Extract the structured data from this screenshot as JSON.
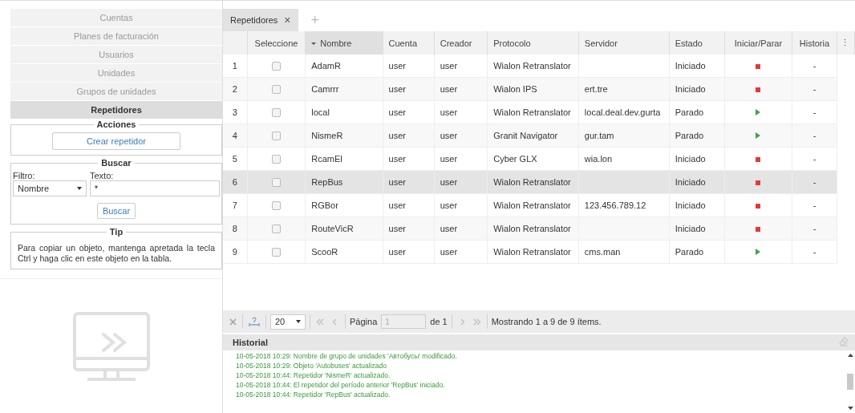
{
  "sidebar": {
    "items": [
      {
        "label": "Cuentas",
        "selected": false
      },
      {
        "label": "Planes de facturación",
        "selected": false
      },
      {
        "label": "Usuarios",
        "selected": false
      },
      {
        "label": "Unidades",
        "selected": false
      },
      {
        "label": "Grupos de unidades",
        "selected": false
      },
      {
        "label": "Repetidores",
        "selected": true
      }
    ]
  },
  "actions": {
    "legend": "Acciones",
    "button": "Crear repetidor"
  },
  "search": {
    "legend": "Buscar",
    "filter_label": "Filtro:",
    "filter_value": "Nombre",
    "text_label": "Texto:",
    "text_value": "*",
    "button": "Buscar"
  },
  "tip": {
    "legend": "Tip",
    "text": "Para copiar un objeto, mantenga apretada la tecla Ctrl y haga clic en este objeto en la tabla."
  },
  "tabs": [
    {
      "label": "Repetidores",
      "close": "×",
      "selected": true
    }
  ],
  "add_tab": "+",
  "table": {
    "columns": [
      {
        "sorted": false
      },
      {
        "label": "Seleccione",
        "sorted": false
      },
      {
        "label": "Nombre",
        "sorted": true
      },
      {
        "label": "Cuenta",
        "sorted": false
      },
      {
        "label": "Creador",
        "sorted": false
      },
      {
        "label": "Protocolo",
        "sorted": false
      },
      {
        "label": "Servidor",
        "sorted": false
      },
      {
        "label": "Estado",
        "sorted": false
      },
      {
        "label": "Iniciar/Parar",
        "sorted": false
      },
      {
        "label": "Historia",
        "sorted": false
      }
    ],
    "menu": "⋮",
    "rows": [
      {
        "num": "1",
        "checked": false,
        "name": "AdamR",
        "account": "user",
        "creator": "user",
        "protocol": "Wialon Retranslator",
        "server": "",
        "state": "Iniciado",
        "kind": "stop",
        "history": "-",
        "selected": false
      },
      {
        "num": "2",
        "checked": false,
        "name": "Camrrr",
        "account": "user",
        "creator": "user",
        "protocol": "Wialon IPS",
        "server": "ert.tre",
        "state": "Iniciado",
        "kind": "stop",
        "history": "-",
        "selected": false
      },
      {
        "num": "3",
        "checked": false,
        "name": "local",
        "account": "user",
        "creator": "user",
        "protocol": "Wialon Retranslator",
        "server": "local.deal.dev.gurta",
        "state": "Parado",
        "kind": "play",
        "history": "-",
        "selected": false
      },
      {
        "num": "4",
        "checked": false,
        "name": "NismeR",
        "account": "user",
        "creator": "user",
        "protocol": "Granit Navigator",
        "server": "gur.tam",
        "state": "Parado",
        "kind": "play",
        "history": "-",
        "selected": false
      },
      {
        "num": "5",
        "checked": false,
        "name": "RcamEl",
        "account": "user",
        "creator": "user",
        "protocol": "Cyber GLX",
        "server": "wia.lon",
        "state": "Iniciado",
        "kind": "stop",
        "history": "-",
        "selected": false
      },
      {
        "num": "6",
        "checked": false,
        "name": "RepBus",
        "account": "user",
        "creator": "user",
        "protocol": "Wialon Retranslator",
        "server": "",
        "state": "Iniciado",
        "kind": "stop",
        "history": "-",
        "selected": true
      },
      {
        "num": "7",
        "checked": false,
        "name": "RGBor",
        "account": "user",
        "creator": "user",
        "protocol": "Wialon Retranslator",
        "server": "123.456.789.12",
        "state": "Iniciado",
        "kind": "stop",
        "history": "-",
        "selected": false
      },
      {
        "num": "8",
        "checked": false,
        "name": "RouteVicR",
        "account": "user",
        "creator": "user",
        "protocol": "Wialon Retranslator",
        "server": "",
        "state": "Iniciado",
        "kind": "stop",
        "history": "-",
        "selected": false
      },
      {
        "num": "9",
        "checked": false,
        "name": "ScooR",
        "account": "user",
        "creator": "user",
        "protocol": "Wialon Retranslator",
        "server": "cms.man",
        "state": "Parado",
        "kind": "play",
        "history": "-",
        "selected": false
      }
    ]
  },
  "pager": {
    "page_size": "20",
    "page_label": "Página",
    "page": "1",
    "of": "de 1",
    "summary": "Mostrando 1 a 9 de 9 ítems."
  },
  "history": {
    "title": "Historial",
    "lines": [
      "10-05-2018 10:29: Nombre de grupo de unidades 'Автобусы' modificado.",
      "10-05-2018 10:29: Objeto 'Autobuses' actualizado",
      "10-05-2018 10:44: Repetidor 'NismeR' actualizado.",
      "10-05-2018 10:44: El repetidor del período anterior 'RepBus' iniciado.",
      "10-05-2018 10:44: Repetidor 'RepBus' actualizado."
    ]
  }
}
